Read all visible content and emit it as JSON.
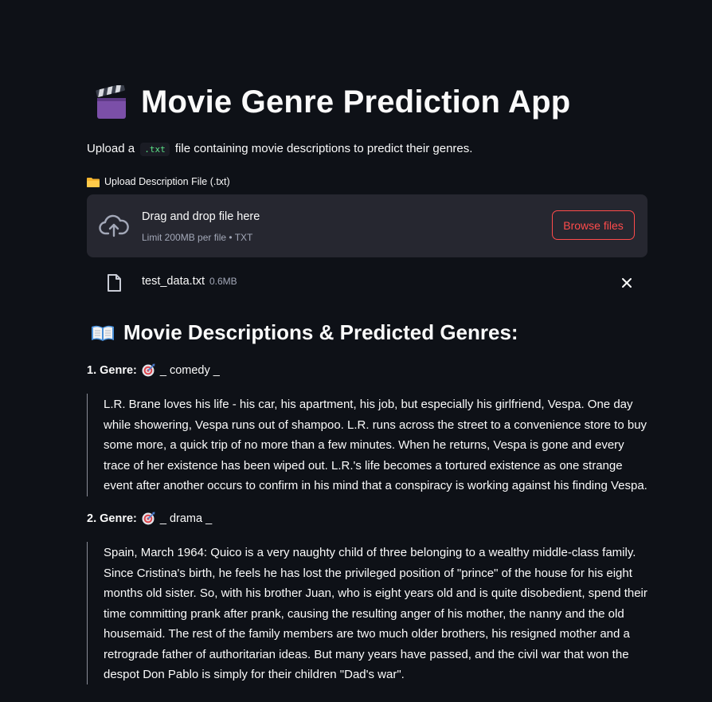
{
  "app": {
    "title": "Movie Genre Prediction App",
    "intro_before": "Upload a",
    "intro_code": ".txt",
    "intro_after": "file containing movie descriptions to predict their genres."
  },
  "uploader": {
    "label": "Upload Description File (.txt)",
    "drag_text": "Drag and drop file here",
    "limit_text": "Limit 200MB per file • TXT",
    "browse_label": "Browse files",
    "file_name": "test_data.txt",
    "file_size": "0.6MB"
  },
  "results": {
    "heading": "Movie Descriptions & Predicted Genres:",
    "items": [
      {
        "label": "1. Genre:",
        "genre": "_ comedy _",
        "description": "L.R. Brane loves his life - his car, his apartment, his job, but especially his girlfriend, Vespa. One day while showering, Vespa runs out of shampoo. L.R. runs across the street to a convenience store to buy some more, a quick trip of no more than a few minutes. When he returns, Vespa is gone and every trace of her existence has been wiped out. L.R.'s life becomes a tortured existence as one strange event after another occurs to confirm in his mind that a conspiracy is working against his finding Vespa."
      },
      {
        "label": "2. Genre:",
        "genre": "_ drama _",
        "description": "Spain, March 1964: Quico is a very naughty child of three belonging to a wealthy middle-class family. Since Cristina's birth, he feels he has lost the privileged position of \"prince\" of the house for his eight months old sister. So, with his brother Juan, who is eight years old and is quite disobedient, spend their time committing prank after prank, causing the resulting anger of his mother, the nanny and the old housemaid. The rest of the family members are two much older brothers, his resigned mother and a retrograde father of authoritarian ideas. But many years have passed, and the civil war that won the despot Don Pablo is simply for their children \"Dad's war\"."
      }
    ]
  },
  "colors": {
    "background": "#0e1117",
    "dropzone": "#262730",
    "accent": "#ff4b4b",
    "code_text": "#5ce488",
    "muted": "#a3a8b8"
  },
  "icons": [
    "clapper-board-icon",
    "folder-icon",
    "cloud-upload-icon",
    "file-icon",
    "close-icon",
    "open-book-icon",
    "direct-hit-icon"
  ]
}
